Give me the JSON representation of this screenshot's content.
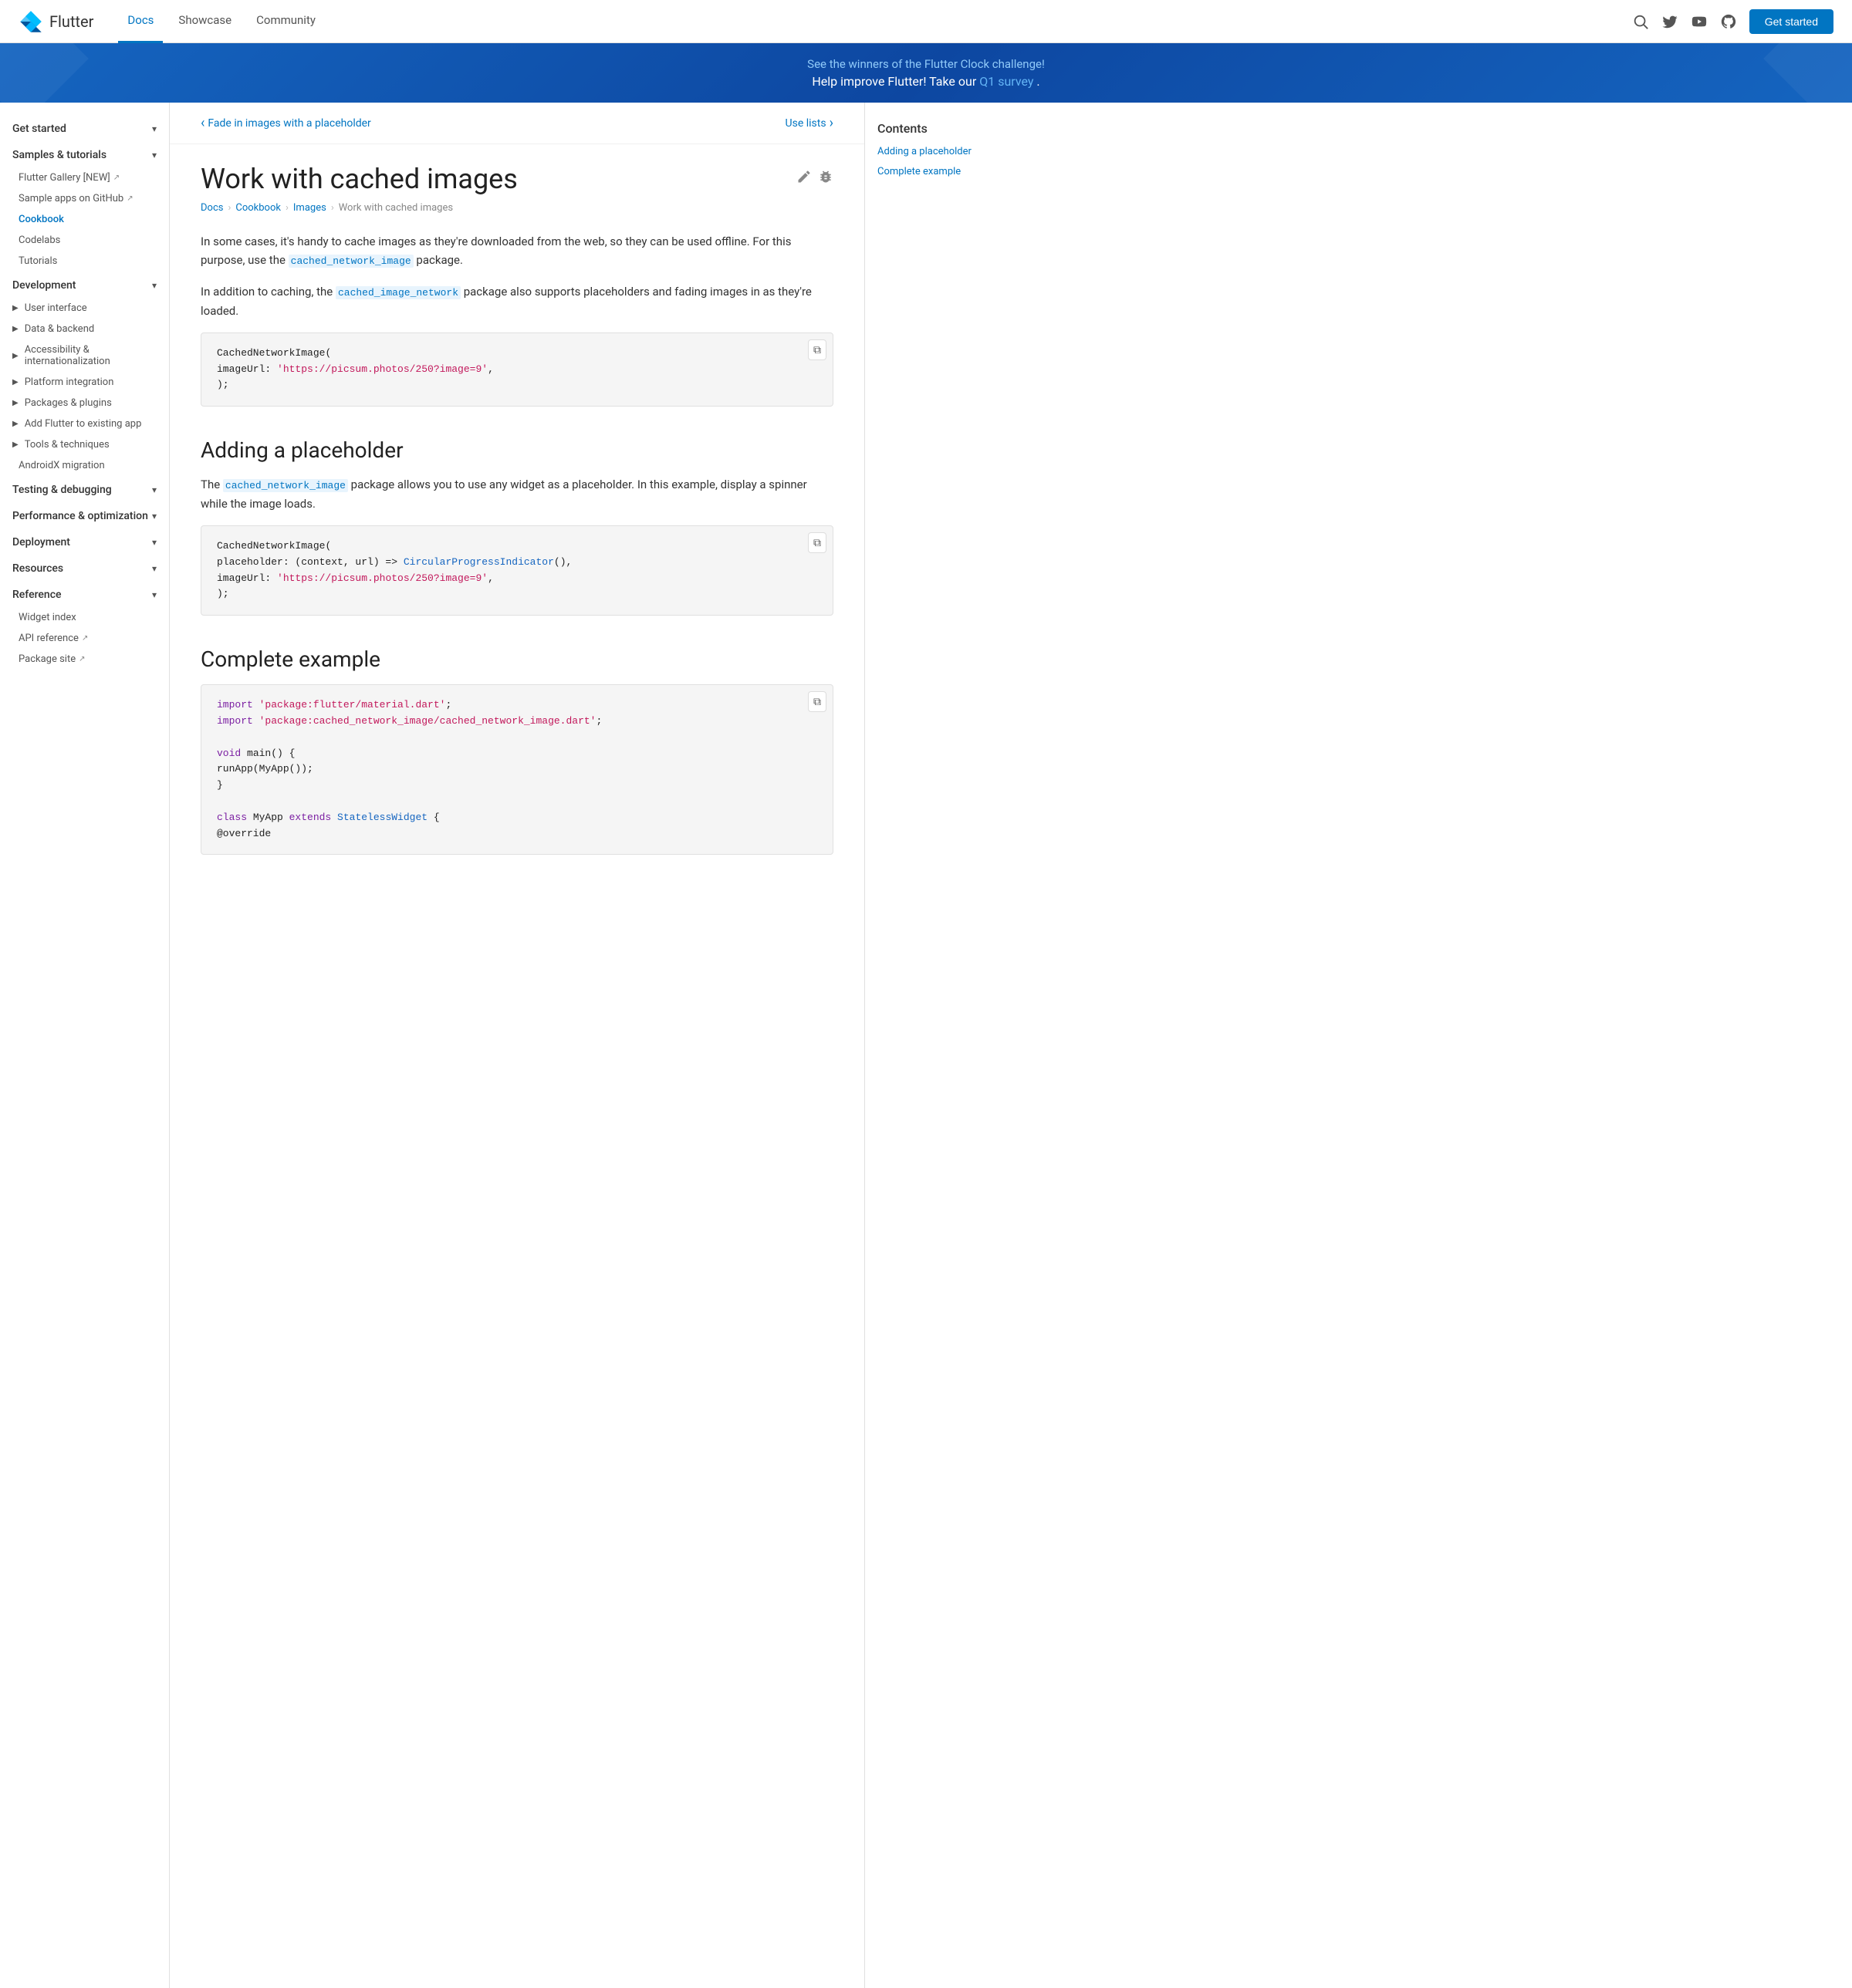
{
  "header": {
    "logo_text": "Flutter",
    "nav_items": [
      {
        "label": "Docs",
        "active": true
      },
      {
        "label": "Showcase",
        "active": false
      },
      {
        "label": "Community",
        "active": false
      }
    ],
    "get_started": "Get started"
  },
  "banner": {
    "line1": "See the winners of the Flutter Clock challenge!",
    "line2_prefix": "Help improve Flutter! Take our ",
    "line2_link": "Q1 survey",
    "line2_suffix": "."
  },
  "sidebar": {
    "sections": [
      {
        "label": "Get started",
        "expanded": true,
        "chevron": "▾"
      },
      {
        "label": "Samples & tutorials",
        "expanded": true,
        "chevron": "▾"
      },
      {
        "label": "Development",
        "expanded": true,
        "chevron": "▾"
      },
      {
        "label": "Testing & debugging",
        "expanded": true,
        "chevron": "▾"
      },
      {
        "label": "Performance & optimization",
        "expanded": true,
        "chevron": "▾"
      },
      {
        "label": "Deployment",
        "expanded": true,
        "chevron": "▾"
      },
      {
        "label": "Resources",
        "expanded": true,
        "chevron": "▾"
      },
      {
        "label": "Reference",
        "expanded": true,
        "chevron": "▾"
      }
    ],
    "samples_items": [
      {
        "label": "Flutter Gallery [NEW]",
        "ext": true
      },
      {
        "label": "Sample apps on GitHub",
        "ext": true
      }
    ],
    "cookbook_label": "Cookbook",
    "other_items": [
      {
        "label": "Codelabs"
      },
      {
        "label": "Tutorials"
      }
    ],
    "dev_items": [
      {
        "label": "User interface",
        "expandable": true
      },
      {
        "label": "Data & backend",
        "expandable": true
      },
      {
        "label": "Accessibility & internationalization",
        "expandable": true
      },
      {
        "label": "Platform integration",
        "expandable": true
      },
      {
        "label": "Packages & plugins",
        "expandable": true
      },
      {
        "label": "Add Flutter to existing app",
        "expandable": true
      },
      {
        "label": "Tools & techniques",
        "expandable": true
      },
      {
        "label": "AndroidX migration"
      }
    ],
    "reference_items": [
      {
        "label": "Widget index"
      },
      {
        "label": "API reference",
        "ext": true
      },
      {
        "label": "Package site",
        "ext": true
      }
    ]
  },
  "page_nav": {
    "prev": "Fade in images with a placeholder",
    "next": "Use lists"
  },
  "page": {
    "title": "Work with cached images",
    "breadcrumb": [
      "Docs",
      "Cookbook",
      "Images",
      "Work with cached images"
    ],
    "intro_para1_prefix": "In some cases, it's handy to cache images as they're downloaded from the web, so they can be used offline. For this purpose, use the ",
    "intro_link1": "cached_network_image",
    "intro_para1_suffix": " package.",
    "intro_para2_prefix": "In addition to caching, the ",
    "intro_link2": "cached_image_network",
    "intro_para2_suffix": " package also supports placeholders and fading images in as they're loaded."
  },
  "code_block1": {
    "lines": [
      {
        "parts": [
          {
            "text": "CachedNetworkImage",
            "cls": "c-class"
          },
          {
            "text": "(",
            "cls": "c-method"
          }
        ]
      },
      {
        "parts": [
          {
            "text": "  imageUrl: ",
            "cls": "c-param"
          },
          {
            "text": "'https://picsum.photos/250?image=9'",
            "cls": "c-string"
          },
          {
            "text": ",",
            "cls": "c-param"
          }
        ]
      },
      {
        "parts": [
          {
            "text": ");",
            "cls": "c-param"
          }
        ]
      }
    ]
  },
  "section1": {
    "title": "Adding a placeholder",
    "intro_prefix": "The ",
    "intro_link": "cached_network_image",
    "intro_suffix": " package allows you to use any widget as a placeholder. In this example, display a spinner while the image loads."
  },
  "code_block2": {
    "lines": [
      {
        "parts": [
          {
            "text": "CachedNetworkImage",
            "cls": "c-class"
          },
          {
            "text": "(",
            "cls": "c-method"
          }
        ]
      },
      {
        "parts": [
          {
            "text": "  placeholder: (context, url) => ",
            "cls": "c-param"
          },
          {
            "text": "CircularProgressIndicator",
            "cls": "c-blue"
          },
          {
            "text": "(),",
            "cls": "c-param"
          }
        ]
      },
      {
        "parts": [
          {
            "text": "  imageUrl: ",
            "cls": "c-param"
          },
          {
            "text": "'https://picsum.photos/250?image=9'",
            "cls": "c-string"
          },
          {
            "text": ",",
            "cls": "c-param"
          }
        ]
      },
      {
        "parts": [
          {
            "text": ");",
            "cls": "c-param"
          }
        ]
      }
    ]
  },
  "section2": {
    "title": "Complete example"
  },
  "code_block3": {
    "lines": [
      {
        "parts": [
          {
            "text": "import ",
            "cls": "c-keyword"
          },
          {
            "text": "'package:flutter/material.dart'",
            "cls": "c-string"
          },
          {
            "text": ";",
            "cls": "c-param"
          }
        ]
      },
      {
        "parts": [
          {
            "text": "import ",
            "cls": "c-keyword"
          },
          {
            "text": "'package:cached_network_image/cached_network_image.dart'",
            "cls": "c-string"
          },
          {
            "text": ";",
            "cls": "c-param"
          }
        ]
      },
      {
        "parts": [
          {
            "text": "",
            "cls": ""
          }
        ]
      },
      {
        "parts": [
          {
            "text": "void ",
            "cls": "c-keyword"
          },
          {
            "text": "main() {",
            "cls": "c-param"
          }
        ]
      },
      {
        "parts": [
          {
            "text": "  runApp(",
            "cls": "c-param"
          },
          {
            "text": "MyApp",
            "cls": "c-class"
          },
          {
            "text": "());",
            "cls": "c-param"
          }
        ]
      },
      {
        "parts": [
          {
            "text": "}",
            "cls": "c-param"
          }
        ]
      },
      {
        "parts": [
          {
            "text": "",
            "cls": ""
          }
        ]
      },
      {
        "parts": [
          {
            "text": "class ",
            "cls": "c-keyword"
          },
          {
            "text": "MyApp ",
            "cls": "c-class"
          },
          {
            "text": "extends ",
            "cls": "c-keyword"
          },
          {
            "text": "StatelessWidget ",
            "cls": "c-blue"
          },
          {
            "text": "{",
            "cls": "c-param"
          }
        ]
      },
      {
        "parts": [
          {
            "text": "  @override",
            "cls": "c-param"
          }
        ]
      }
    ]
  },
  "contents": {
    "title": "Contents",
    "items": [
      {
        "label": "Adding a placeholder"
      },
      {
        "label": "Complete example"
      }
    ]
  }
}
